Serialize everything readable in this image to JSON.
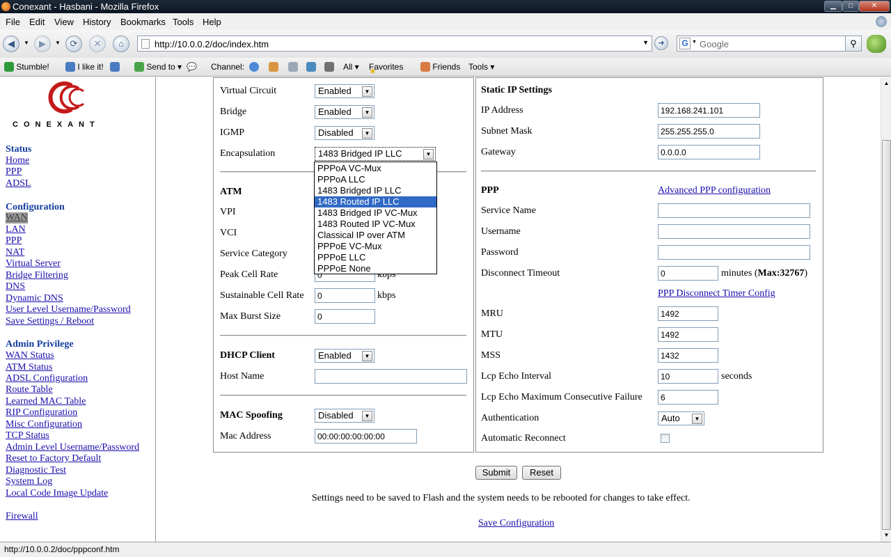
{
  "window": {
    "title": "Conexant - Hasbani - Mozilla Firefox"
  },
  "menu": [
    "File",
    "Edit",
    "View",
    "History",
    "Bookmarks",
    "Tools",
    "Help"
  ],
  "nav": {
    "url": "http://10.0.0.2/doc/index.htm",
    "search_placeholder": "Google"
  },
  "toolbar": {
    "stumble": "Stumble!",
    "ilike": "I like it!",
    "sendto": "Send to",
    "channel": "Channel:",
    "all": "All",
    "favorites": "Favorites",
    "friends": "Friends",
    "tools": "Tools"
  },
  "logo": {
    "text": "CONEXANT"
  },
  "sidebar": {
    "status_heading": "Status",
    "status_links": [
      "Home",
      "PPP",
      "ADSL"
    ],
    "config_heading": "Configuration",
    "config_links": [
      "WAN",
      "LAN",
      "PPP",
      "NAT",
      "Virtual Server",
      "Bridge Filtering",
      "DNS",
      "Dynamic DNS",
      "User Level Username/Password",
      "Save Settings / Reboot"
    ],
    "admin_heading": "Admin Privilege",
    "admin_links": [
      "WAN Status",
      "ATM Status",
      "ADSL Configuration",
      "Route Table",
      "Learned MAC Table",
      "RIP Configuration",
      "Misc Configuration",
      "TCP Status",
      "Admin Level Username/Password",
      "Reset to Factory Default",
      "Diagnostic Test",
      "System Log",
      "Local Code Image Update"
    ],
    "firewall": "Firewall"
  },
  "left": {
    "virtual_circuit": {
      "label": "Virtual Circuit",
      "value": "Enabled"
    },
    "bridge": {
      "label": "Bridge",
      "value": "Enabled"
    },
    "igmp": {
      "label": "IGMP",
      "value": "Disabled"
    },
    "encapsulation": {
      "label": "Encapsulation",
      "value": "1483 Bridged IP LLC"
    },
    "atm_heading": "ATM",
    "vpi": "VPI",
    "vci": "VCI",
    "service_category": "Service Category",
    "peak_cell_rate": {
      "label": "Peak Cell Rate",
      "value": "0",
      "unit": "kbps"
    },
    "sustainable_cell_rate": {
      "label": "Sustainable Cell Rate",
      "value": "0",
      "unit": "kbps"
    },
    "max_burst_size": {
      "label": "Max Burst Size",
      "value": "0"
    },
    "dhcp_heading": "DHCP Client",
    "dhcp_value": "Enabled",
    "host_name": {
      "label": "Host Name",
      "value": ""
    },
    "mac_spoof_heading": "MAC Spoofing",
    "mac_spoof_value": "Disabled",
    "mac_address": {
      "label": "Mac Address",
      "value": "00:00:00:00:00:00"
    }
  },
  "encap_options": [
    "PPPoA VC-Mux",
    "PPPoA LLC",
    "1483 Bridged IP LLC",
    "1483 Routed IP LLC",
    "1483 Bridged IP VC-Mux",
    "1483 Routed IP VC-Mux",
    "Classical IP over ATM",
    "PPPoE VC-Mux",
    "PPPoE LLC",
    "PPPoE None"
  ],
  "encap_highlighted": "1483 Routed IP LLC",
  "right": {
    "static_heading": "Static IP Settings",
    "ip_address": {
      "label": "IP Address",
      "value": "192.168.241.101"
    },
    "subnet_mask": {
      "label": "Subnet Mask",
      "value": "255.255.255.0"
    },
    "gateway": {
      "label": "Gateway",
      "value": "0.0.0.0"
    },
    "ppp_heading": "PPP",
    "adv_ppp_link": "Advanced PPP configuration",
    "service_name": {
      "label": "Service Name",
      "value": ""
    },
    "username": {
      "label": "Username",
      "value": ""
    },
    "password": {
      "label": "Password",
      "value": ""
    },
    "disconnect_timeout": {
      "label": "Disconnect Timeout",
      "value": "0",
      "suffix": "minutes (",
      "max": "Max:32767",
      "close": ")"
    },
    "disc_timer_link": "PPP Disconnect Timer Config",
    "mru": {
      "label": "MRU",
      "value": "1492"
    },
    "mtu": {
      "label": "MTU",
      "value": "1492"
    },
    "mss": {
      "label": "MSS",
      "value": "1432"
    },
    "lcp_interval": {
      "label": "Lcp Echo Interval",
      "value": "10",
      "unit": "seconds"
    },
    "lcp_max_fail": {
      "label": "Lcp Echo Maximum Consecutive Failure",
      "value": "6"
    },
    "authentication": {
      "label": "Authentication",
      "value": "Auto"
    },
    "auto_reconnect": {
      "label": "Automatic Reconnect",
      "checked": false
    }
  },
  "actions": {
    "submit": "Submit",
    "reset": "Reset",
    "note": "Settings need to be saved to Flash and the system needs to be rebooted for changes to take effect.",
    "save_link": "Save Configuration"
  },
  "status": {
    "text": "http://10.0.0.2/doc/pppconf.htm"
  }
}
